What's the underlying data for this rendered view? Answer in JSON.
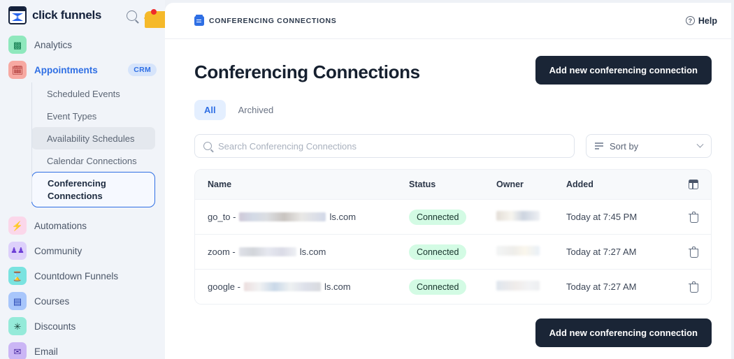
{
  "brand": {
    "name": "click funnels",
    "logo_icon": "clickfunnels-logo",
    "search_icon": "search-icon",
    "bell_icon": "bell-icon",
    "has_notification": true
  },
  "sidebar": {
    "top_items": [
      {
        "label": "Analytics",
        "icon": "chart-icon",
        "icon_bg": "#8fe8bd",
        "icon_fg": "#0f7a4d",
        "glyph": "☳",
        "badge": null,
        "active": false
      },
      {
        "label": "Appointments",
        "icon": "calendar-edit-icon",
        "icon_bg": "#f7a9a2",
        "icon_fg": "#9b1c1c",
        "glyph": "Ὕ3",
        "badge": "CRM",
        "active": true
      }
    ],
    "sub_items": [
      {
        "label": "Scheduled Events",
        "state": "normal"
      },
      {
        "label": "Event Types",
        "state": "normal"
      },
      {
        "label": "Availability Schedules",
        "state": "hover"
      },
      {
        "label": "Calendar Connections",
        "state": "normal"
      },
      {
        "label": "Conferencing Connections",
        "state": "selected"
      }
    ],
    "bottom_items": [
      {
        "label": "Automations",
        "icon": "lightning-icon",
        "icon_bg": "#fbd7ea",
        "icon_fg": "#e0348a",
        "glyph": "⚡"
      },
      {
        "label": "Community",
        "icon": "people-icon",
        "icon_bg": "#ddd0fb",
        "icon_fg": "#6d3fd6",
        "glyph": "♟"
      },
      {
        "label": "Countdown Funnels",
        "icon": "hourglass-icon",
        "icon_bg": "#7ae3e0",
        "icon_fg": "#0e6f8a",
        "glyph": "⧖"
      },
      {
        "label": "Courses",
        "icon": "book-icon",
        "icon_bg": "#a8c6fb",
        "icon_fg": "#1f3faf",
        "glyph": "▤"
      },
      {
        "label": "Discounts",
        "icon": "discount-icon",
        "icon_bg": "#95ead9",
        "icon_fg": "#143a33",
        "glyph": "✳"
      },
      {
        "label": "Email",
        "icon": "envelope-icon",
        "icon_bg": "#cbb6f5",
        "icon_fg": "#45259e",
        "glyph": "✉"
      }
    ]
  },
  "topbar": {
    "breadcrumb": "CONFERENCING CONNECTIONS",
    "breadcrumb_icon": "calendar-edit-icon",
    "help_label": "Help",
    "help_icon": "question-circle-icon"
  },
  "page": {
    "title": "Conferencing Connections",
    "primary_button": "Add new conferencing connection",
    "footer_button": "Add new conferencing connection"
  },
  "tabs": [
    {
      "label": "All",
      "active": true
    },
    {
      "label": "Archived",
      "active": false
    }
  ],
  "search": {
    "placeholder": "Search Conferencing Connections",
    "value": "",
    "icon": "search-icon"
  },
  "sort": {
    "label": "Sort by",
    "icon": "sort-lines-icon",
    "chevron": "chevron-down-icon"
  },
  "table": {
    "columns": [
      "Name",
      "Status",
      "Owner",
      "Added"
    ],
    "column_settings_icon": "columns-icon",
    "rows": [
      {
        "name_prefix": "go_to -",
        "name_redacted": true,
        "name_suffix": "ls.com",
        "status": "Connected",
        "owner_redacted": true,
        "added": "Today at 7:45 PM",
        "delete_icon": "trash-icon"
      },
      {
        "name_prefix": "zoom -",
        "name_redacted": true,
        "name_suffix": "ls.com",
        "status": "Connected",
        "owner_redacted": true,
        "added": "Today at 7:27 AM",
        "delete_icon": "trash-icon"
      },
      {
        "name_prefix": "google -",
        "name_redacted": true,
        "name_suffix": "ls.com",
        "status": "Connected",
        "owner_redacted": true,
        "added": "Today at 7:27 AM",
        "delete_icon": "trash-icon"
      }
    ]
  },
  "colors": {
    "accent_blue": "#2f6fe4",
    "dark_button": "#1a2536",
    "status_badge_bg": "#d3fbe4",
    "status_badge_fg": "#15322a",
    "sidebar_bg": "#f1f4f9"
  }
}
